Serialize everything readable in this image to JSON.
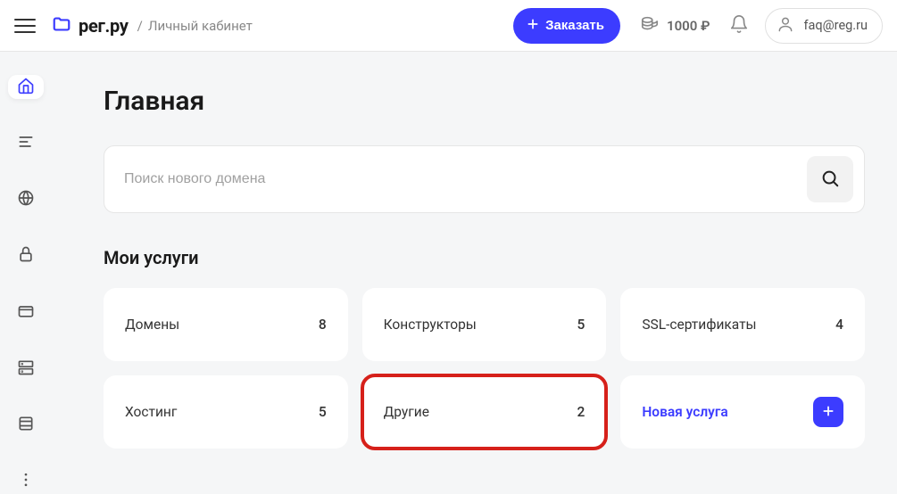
{
  "header": {
    "logo_text": "рег.ру",
    "breadcrumb": "Личный кабинет",
    "order_label": "Заказать",
    "balance": "1000 ₽",
    "user_email": "faq@reg.ru"
  },
  "sidebar": {
    "items": [
      {
        "name": "home",
        "active": true
      },
      {
        "name": "list",
        "active": false
      },
      {
        "name": "globe",
        "active": false
      },
      {
        "name": "lock",
        "active": false
      },
      {
        "name": "billing",
        "active": false
      },
      {
        "name": "server",
        "active": false
      },
      {
        "name": "storage",
        "active": false
      },
      {
        "name": "more",
        "active": false
      }
    ]
  },
  "page": {
    "title": "Главная",
    "search_placeholder": "Поиск нового домена",
    "section_title": "Мои услуги"
  },
  "services": [
    {
      "label": "Домены",
      "count": "8",
      "highlighted": false
    },
    {
      "label": "Конструкторы",
      "count": "5",
      "highlighted": false
    },
    {
      "label": "SSL-сертификаты",
      "count": "4",
      "highlighted": false
    },
    {
      "label": "Хостинг",
      "count": "5",
      "highlighted": false
    },
    {
      "label": "Другие",
      "count": "2",
      "highlighted": true
    }
  ],
  "new_service": {
    "label": "Новая услуга"
  },
  "colors": {
    "accent": "#3c3cff",
    "highlight": "#d6201a"
  }
}
